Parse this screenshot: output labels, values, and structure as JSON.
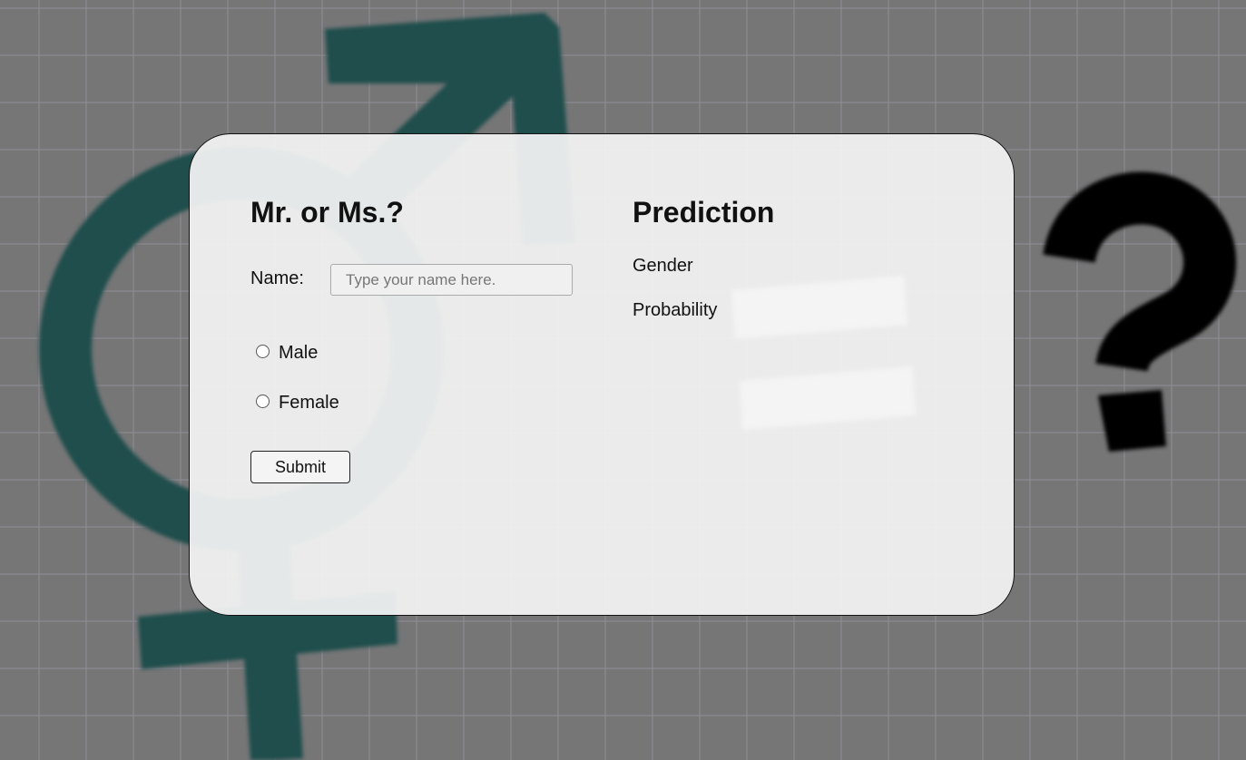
{
  "form": {
    "title": "Mr. or Ms.?",
    "name_label": "Name:",
    "name_placeholder": "Type your name here.",
    "name_value": "",
    "gender_options": [
      "Male",
      "Female"
    ],
    "submit_label": "Submit"
  },
  "prediction": {
    "title": "Prediction",
    "gender_label": "Gender",
    "gender_value": "",
    "probability_label": "Probability",
    "probability_value": ""
  },
  "colors": {
    "symbol_teal": "#1f4e4c",
    "card_background": "#f4f4f4",
    "page_background": "#767677"
  },
  "icons": [
    "gender-symbol-icon",
    "question-mark-icon",
    "equals-icon"
  ]
}
